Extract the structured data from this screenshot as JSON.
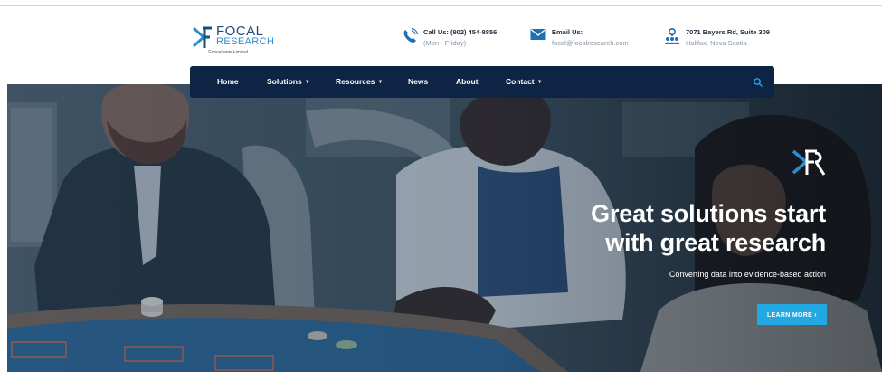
{
  "logo": {
    "top": "FOCAL",
    "mid": "RESEARCH",
    "sub": "Consultants Limited"
  },
  "contact": {
    "phone": {
      "label": "Call Us: (902) 454-8856",
      "detail": "(Mon - Friday)",
      "icon": "phone-icon"
    },
    "email": {
      "label": "Email Us:",
      "detail": "focal@focalresearch.com",
      "icon": "envelope-icon"
    },
    "address": {
      "label": "7071 Bayers Rd, Suite 309",
      "detail": "Halifax, Nova Scotia",
      "icon": "location-people-icon"
    }
  },
  "nav": {
    "items": [
      {
        "label": "Home",
        "has_dropdown": false
      },
      {
        "label": "Solutions",
        "has_dropdown": true
      },
      {
        "label": "Resources",
        "has_dropdown": true
      },
      {
        "label": "News",
        "has_dropdown": false
      },
      {
        "label": "About",
        "has_dropdown": false
      },
      {
        "label": "Contact",
        "has_dropdown": true
      }
    ],
    "search_icon": "search-icon"
  },
  "hero": {
    "headline_line1": "Great solutions start",
    "headline_line2": "with great research",
    "tagline": "Converting data into evidence-based action",
    "button_label": "LEARN MORE",
    "button_chevron": "›"
  },
  "colors": {
    "brand_dark": "#0d2444",
    "accent": "#22a9e4",
    "logo_blue": "#1d4d7a",
    "logo_light": "#2c8fd1"
  }
}
